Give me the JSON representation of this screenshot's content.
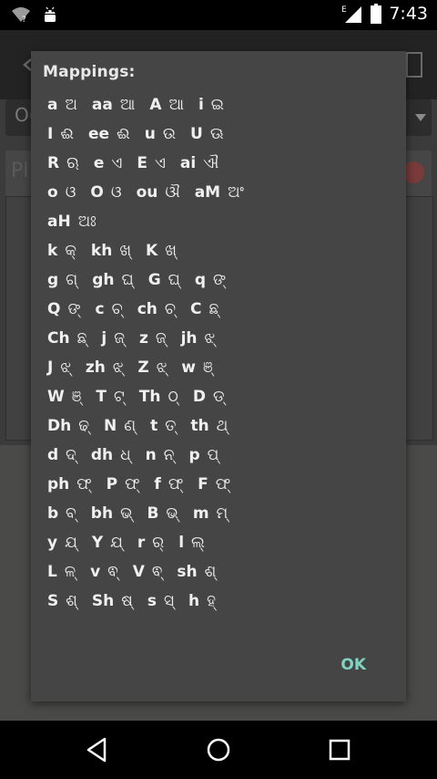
{
  "status_bar": {
    "time": "7:43",
    "network_label": "E",
    "icons": [
      "wifi-icon",
      "android-icon",
      "signal-icon",
      "battery-icon"
    ]
  },
  "background_app": {
    "dropdown_text": "O(",
    "input_placeholder": "Pl"
  },
  "dialog": {
    "title": "Mappings:",
    "ok_label": "OK",
    "rows": [
      [
        [
          "a",
          "ଅ"
        ],
        [
          "aa",
          "ଆ"
        ],
        [
          "A",
          "ଆ"
        ],
        [
          "i",
          "ଇ"
        ]
      ],
      [
        [
          "I",
          "ଈ"
        ],
        [
          "ee",
          "ଈ"
        ],
        [
          "u",
          "ଉ"
        ],
        [
          "U",
          "ଊ"
        ]
      ],
      [
        [
          "R",
          "ଋ"
        ],
        [
          "e",
          "ଏ"
        ],
        [
          "E",
          "ଏ"
        ],
        [
          "ai",
          "ଐ"
        ]
      ],
      [
        [
          "o",
          "ଓ"
        ],
        [
          "O",
          "ଓ"
        ],
        [
          "ou",
          "ଔ"
        ],
        [
          "aM",
          "ଅଂ"
        ]
      ],
      [
        [
          "aH",
          "ଅଃ"
        ]
      ],
      [
        [
          "k",
          "କ୍"
        ],
        [
          "kh",
          "ଖ୍"
        ],
        [
          "K",
          "ଖ୍"
        ]
      ],
      [
        [
          "g",
          "ଗ୍"
        ],
        [
          "gh",
          "ଘ୍"
        ],
        [
          "G",
          "ଘ୍"
        ],
        [
          "q",
          "ଙ୍"
        ]
      ],
      [
        [
          "Q",
          "ଙ୍"
        ],
        [
          "c",
          "ଚ୍"
        ],
        [
          "ch",
          "ଚ୍"
        ],
        [
          "C",
          "ଛ୍"
        ]
      ],
      [
        [
          "Ch",
          "ଛ୍"
        ],
        [
          "j",
          "ଜ୍"
        ],
        [
          "z",
          "ଜ୍"
        ],
        [
          "jh",
          "ଝ୍"
        ]
      ],
      [
        [
          "J",
          "ଝ୍"
        ],
        [
          "zh",
          "ଝ୍"
        ],
        [
          "Z",
          "ଝ୍"
        ],
        [
          "w",
          "ଞ୍"
        ]
      ],
      [
        [
          "W",
          "ଞ୍"
        ],
        [
          "T",
          "ଟ୍"
        ],
        [
          "Th",
          "ଠ୍"
        ],
        [
          "D",
          "ଡ୍"
        ]
      ],
      [
        [
          "Dh",
          "ଢ୍"
        ],
        [
          "N",
          "ଣ୍"
        ],
        [
          "t",
          "ତ୍"
        ],
        [
          "th",
          "ଥ୍"
        ]
      ],
      [
        [
          "d",
          "ଦ୍"
        ],
        [
          "dh",
          "ଧ୍"
        ],
        [
          "n",
          "ନ୍"
        ],
        [
          "p",
          "ପ୍"
        ]
      ],
      [
        [
          "ph",
          "ଫ୍"
        ],
        [
          "P",
          "ଫ୍"
        ],
        [
          "f",
          "ଫ୍"
        ],
        [
          "F",
          "ଫ୍"
        ]
      ],
      [
        [
          "b",
          "ବ୍"
        ],
        [
          "bh",
          "ଭ୍"
        ],
        [
          "B",
          "ଭ୍"
        ],
        [
          "m",
          "ମ୍"
        ]
      ],
      [
        [
          "y",
          "ଯ୍"
        ],
        [
          "Y",
          "ଯ୍"
        ],
        [
          "r",
          "ର୍"
        ],
        [
          "l",
          "ଲ୍"
        ]
      ],
      [
        [
          "L",
          "ଳ୍"
        ],
        [
          "v",
          "ଵ୍"
        ],
        [
          "V",
          "ଵ୍"
        ],
        [
          "sh",
          "ଶ୍"
        ]
      ],
      [
        [
          "S",
          "ଶ୍"
        ],
        [
          "Sh",
          "ଷ୍"
        ],
        [
          "s",
          "ସ୍"
        ],
        [
          "h",
          "ହ୍"
        ]
      ]
    ]
  },
  "nav_bar": {
    "buttons": [
      "back-icon",
      "home-icon",
      "recents-icon"
    ]
  }
}
